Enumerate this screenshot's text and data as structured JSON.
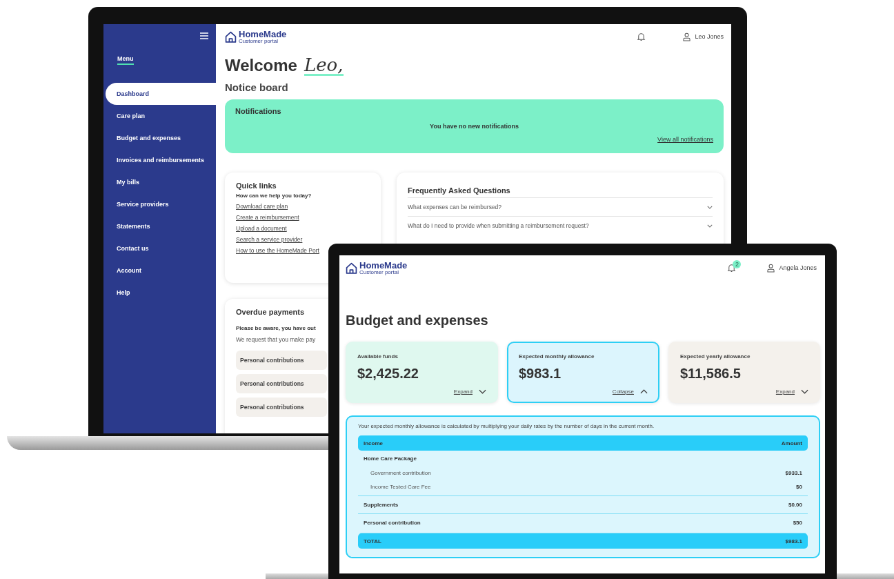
{
  "laptop": {
    "sidebar": {
      "menu_label": "Menu",
      "items": [
        {
          "label": "Dashboard",
          "selected": true
        },
        {
          "label": "Care plan",
          "selected": false
        },
        {
          "label": "Budget and expenses",
          "selected": false
        },
        {
          "label": "Invoices and reimbursements",
          "selected": false
        },
        {
          "label": "My bills",
          "selected": false
        },
        {
          "label": "Service providers",
          "selected": false
        },
        {
          "label": "Statements",
          "selected": false
        },
        {
          "label": "Contact us",
          "selected": false
        },
        {
          "label": "Account",
          "selected": false
        },
        {
          "label": "Help",
          "selected": false
        }
      ]
    },
    "header": {
      "logo": {
        "name": "HomeMade",
        "tagline": "Customer portal"
      },
      "user": "Leo Jones"
    },
    "welcome": "Welcome",
    "welcome_name": "Leo,",
    "notice_board": {
      "title": "Notice board",
      "notifications": {
        "title": "Notifications",
        "message": "You have no new notifications",
        "link": "View all notifications"
      }
    },
    "quick_links": {
      "title": "Quick links",
      "subtitle": "How can we help you today?",
      "links": [
        "Download care plan",
        "Create a reimbursement",
        "Upload a document",
        "Search a service provider",
        "How to use the HomeMade Port"
      ]
    },
    "faq": {
      "title": "Frequently Asked Questions",
      "questions": [
        {
          "text": "What expenses can be reimbursed?",
          "expanded": false
        },
        {
          "text": "What do I need to provide when submitting a reimbursement request?",
          "expanded": false
        }
      ]
    },
    "overdue": {
      "title": "Overdue payments",
      "notice": "Please be aware, you have out",
      "request": "We request that you make pay",
      "rows": [
        "Personal contributions",
        "Personal contributions",
        "Personal contributions"
      ]
    }
  },
  "tablet": {
    "header": {
      "logo": {
        "name": "HomeMade",
        "tagline": "Customer portal"
      },
      "notification_count": "2",
      "user": "Angela Jones"
    },
    "title": "Budget and expenses",
    "cards": [
      {
        "label": "Available funds",
        "amount": "$2,425.22",
        "toggle": "Expand",
        "expanded": false,
        "color": "#dff8ef"
      },
      {
        "label": "Expected monthly allowance",
        "amount": "$983.1",
        "toggle": "Collapse",
        "expanded": true,
        "color": "#dcf5fd"
      },
      {
        "label": "Expected yearly allowance",
        "amount": "$11,586.5",
        "toggle": "Expand",
        "expanded": false,
        "color": "#f4f1ec"
      }
    ],
    "detail": {
      "description": "Your expected monthly allowance is calculated by multiplying your daily rates by the number of days in the current month.",
      "columns": [
        "Income",
        "Amount"
      ],
      "rows": [
        {
          "kind": "group",
          "label": "Home Care Package"
        },
        {
          "kind": "sub",
          "label": "Government contribution",
          "amount": "$933.1"
        },
        {
          "kind": "sub",
          "label": "Income Tested Care Fee",
          "amount": "$0"
        },
        {
          "kind": "line",
          "label": "Supplements",
          "amount": "$0.00"
        },
        {
          "kind": "line",
          "label": "Personal contribution",
          "amount": "$50"
        },
        {
          "kind": "total",
          "label": "TOTAL",
          "amount": "$983.1"
        }
      ]
    }
  }
}
